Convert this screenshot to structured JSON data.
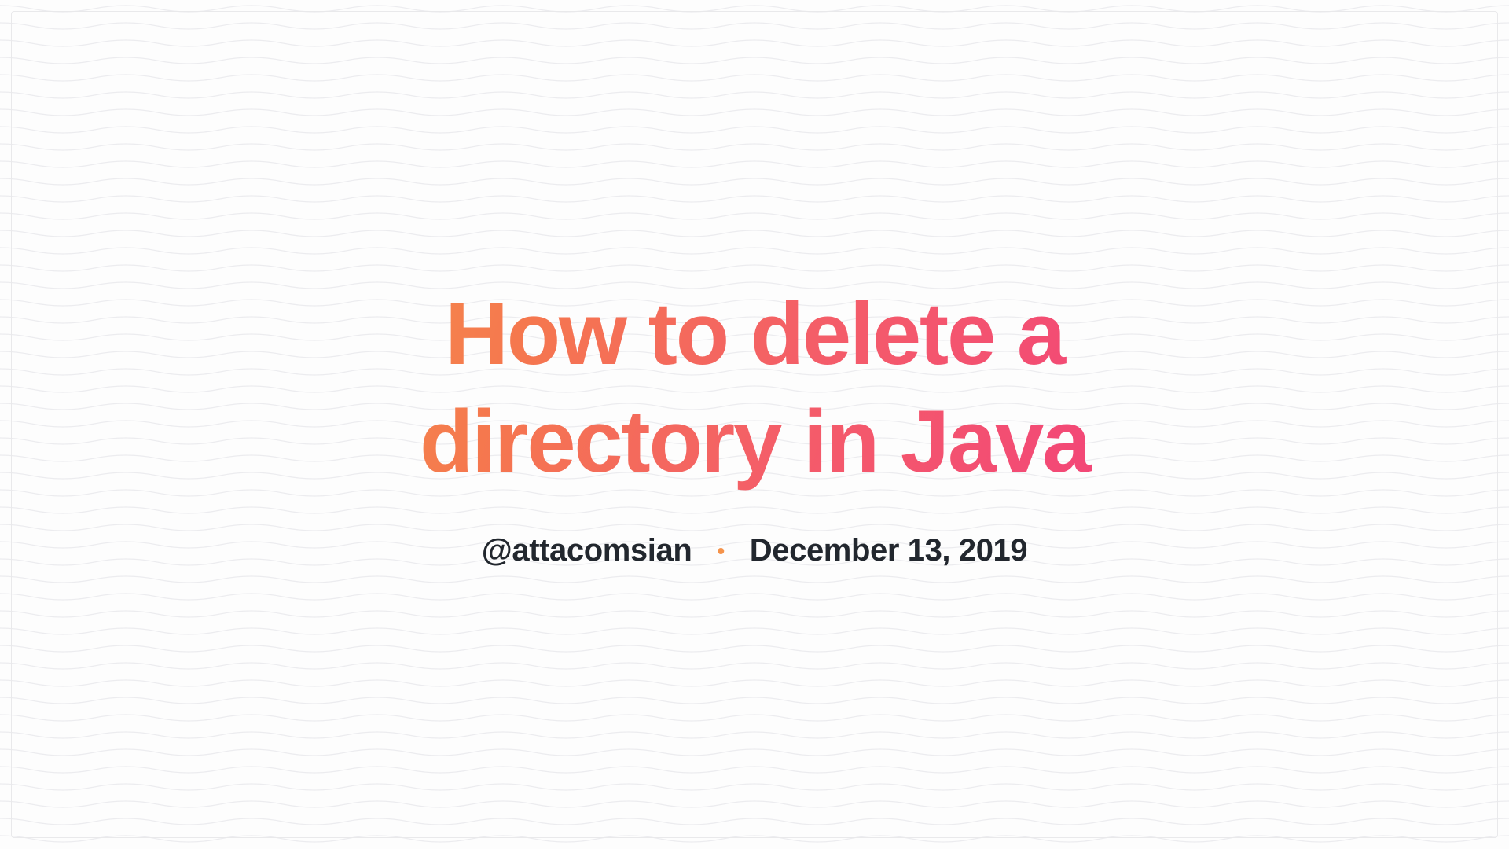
{
  "title": "How to delete a directory in Java",
  "author_handle": "@attacomsian",
  "date": "December 13, 2019",
  "separator": "•"
}
